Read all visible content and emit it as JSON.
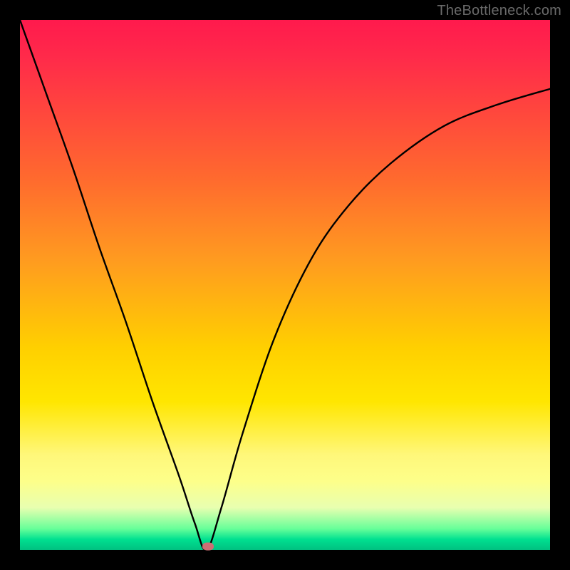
{
  "watermark": "TheBottleneck.com",
  "chart_data": {
    "type": "line",
    "title": "",
    "xlabel": "",
    "ylabel": "",
    "xlim": [
      0,
      1
    ],
    "ylim": [
      0,
      1
    ],
    "series": [
      {
        "name": "curve",
        "x": [
          0.0,
          0.05,
          0.1,
          0.15,
          0.2,
          0.25,
          0.3,
          0.33,
          0.352,
          0.38,
          0.42,
          0.48,
          0.55,
          0.62,
          0.7,
          0.8,
          0.9,
          1.0
        ],
        "y": [
          1.0,
          0.86,
          0.72,
          0.57,
          0.43,
          0.28,
          0.14,
          0.05,
          0.0,
          0.08,
          0.22,
          0.4,
          0.55,
          0.65,
          0.73,
          0.8,
          0.84,
          0.87
        ]
      }
    ],
    "marker": {
      "x": 0.355,
      "y": 0.007
    },
    "colors": {
      "line": "#000000",
      "marker": "#cc6f74",
      "gradient_top": "#ff1a4d",
      "gradient_mid": "#ffe600",
      "gradient_bottom": "#00c080",
      "frame": "#000000"
    }
  }
}
